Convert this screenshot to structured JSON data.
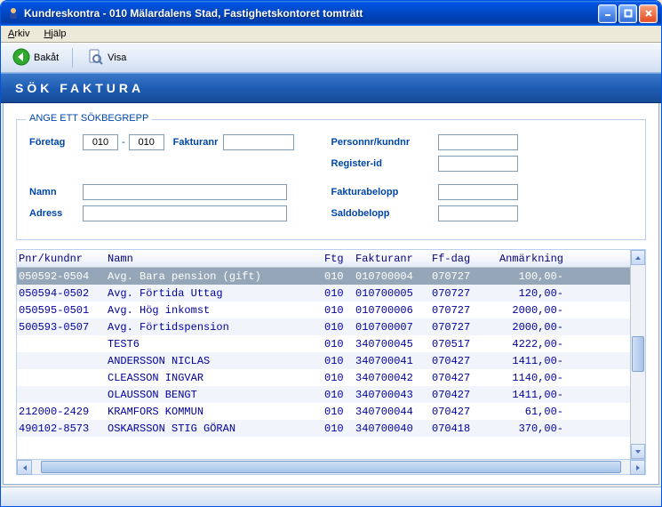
{
  "window": {
    "title": "Kundreskontra  -  010 Mälardalens Stad, Fastighetskontoret tomträtt"
  },
  "menu": {
    "arkiv": "Arkiv",
    "hjalp": "Hjälp"
  },
  "toolbar": {
    "back_label": "Bakåt",
    "visa_label": "Visa"
  },
  "header": {
    "title": "SÖK FAKTURA"
  },
  "search": {
    "legend": "ANGE ETT SÖKBEGREPP",
    "foretag_label": "Företag",
    "foretag_from": "010",
    "foretag_to": "010",
    "fakturanr_label": "Fakturanr",
    "fakturanr_value": "",
    "personnr_label": "Personnr/kundnr",
    "personnr_value": "",
    "registerid_label": "Register-id",
    "registerid_value": "",
    "namn_label": "Namn",
    "namn_value": "",
    "adress_label": "Adress",
    "adress_value": "",
    "fakturabelopp_label": "Fakturabelopp",
    "fakturabelopp_value": "",
    "saldobelopp_label": "Saldobelopp",
    "saldobelopp_value": ""
  },
  "grid": {
    "headers": {
      "pnr": "Pnr/kundnr",
      "namn": "Namn",
      "ftg": "Ftg",
      "fakturanr": "Fakturanr",
      "ffdag": "Ff-dag",
      "anm": "Anmärkning"
    },
    "rows": [
      {
        "pnr": "050592-0504",
        "namn": "Avg. Bara pension (gift)",
        "ftg": "010",
        "fnr": "010700004",
        "ffdag": "070727",
        "anm": "100,00-",
        "selected": true
      },
      {
        "pnr": "050594-0502",
        "namn": "Avg. Förtida Uttag",
        "ftg": "010",
        "fnr": "010700005",
        "ffdag": "070727",
        "anm": "120,00-"
      },
      {
        "pnr": "050595-0501",
        "namn": "Avg. Hög inkomst",
        "ftg": "010",
        "fnr": "010700006",
        "ffdag": "070727",
        "anm": "2000,00-"
      },
      {
        "pnr": "500593-0507",
        "namn": "Avg. Förtidspension",
        "ftg": "010",
        "fnr": "010700007",
        "ffdag": "070727",
        "anm": "2000,00-"
      },
      {
        "pnr": "",
        "namn": "TEST6",
        "ftg": "010",
        "fnr": "340700045",
        "ffdag": "070517",
        "anm": "4222,00-"
      },
      {
        "pnr": "",
        "namn": "ANDERSSON NICLAS",
        "ftg": "010",
        "fnr": "340700041",
        "ffdag": "070427",
        "anm": "1411,00-"
      },
      {
        "pnr": "",
        "namn": "CLEASSON INGVAR",
        "ftg": "010",
        "fnr": "340700042",
        "ffdag": "070427",
        "anm": "1140,00-"
      },
      {
        "pnr": "",
        "namn": "OLAUSSON BENGT",
        "ftg": "010",
        "fnr": "340700043",
        "ffdag": "070427",
        "anm": "1411,00-"
      },
      {
        "pnr": "212000-2429",
        "namn": "KRAMFORS KOMMUN",
        "ftg": "010",
        "fnr": "340700044",
        "ffdag": "070427",
        "anm": "61,00-"
      },
      {
        "pnr": "490102-8573",
        "namn": "OSKARSSON STIG  GÖRAN",
        "ftg": "010",
        "fnr": "340700040",
        "ffdag": "070418",
        "anm": "370,00-"
      }
    ]
  }
}
